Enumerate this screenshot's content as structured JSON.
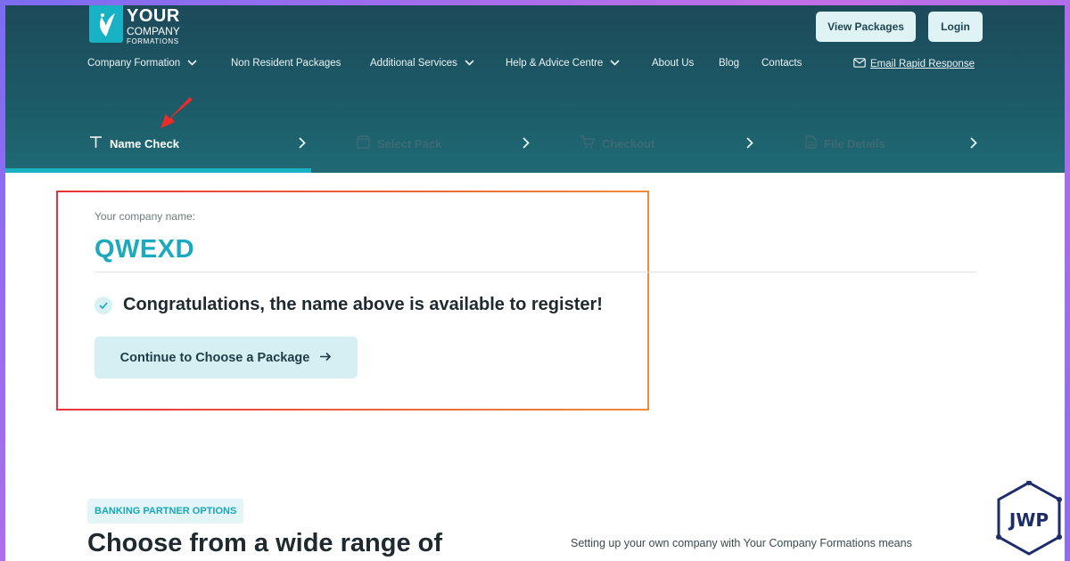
{
  "brand": {
    "line1": "YOUR",
    "line2": "COMPANY",
    "line3": "FORMATIONS",
    "accent": "#19b2c4"
  },
  "header": {
    "view_packages": "View Packages",
    "login": "Login",
    "nav": [
      {
        "label": "Company Formation",
        "dropdown": true
      },
      {
        "label": "Non Resident Packages",
        "dropdown": false
      },
      {
        "label": "Additional Services",
        "dropdown": true
      },
      {
        "label": "Help & Advice Centre",
        "dropdown": true
      },
      {
        "label": "About Us",
        "dropdown": false
      },
      {
        "label": "Blog",
        "dropdown": false
      },
      {
        "label": "Contacts",
        "dropdown": false
      }
    ],
    "email_link": "Email Rapid Response"
  },
  "steps": [
    {
      "label": "Name Check",
      "icon": "text-icon",
      "active": true
    },
    {
      "label": "Select Pack",
      "icon": "package-icon",
      "active": false
    },
    {
      "label": "Checkout",
      "icon": "cart-icon",
      "active": false
    },
    {
      "label": "File Details",
      "icon": "document-icon",
      "active": false
    }
  ],
  "result": {
    "label": "Your company name:",
    "name": "QWEXD",
    "message": "Congratulations, the name above is available to register!",
    "continue_label": "Continue to Choose a Package"
  },
  "banking": {
    "tag": "BANKING PARTNER OPTIONS",
    "heading": "Choose from a wide range of",
    "paragraph": "Setting up your own company with Your Company Formations means"
  },
  "watermark": {
    "text": "JWP"
  }
}
